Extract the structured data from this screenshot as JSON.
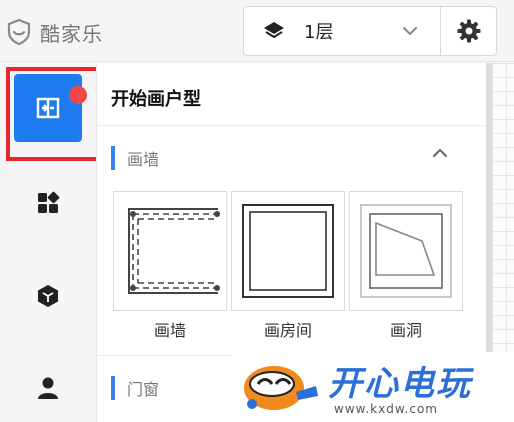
{
  "brand": {
    "name": "酷家乐",
    "logo_icon": "shield-logo-icon"
  },
  "header": {
    "floor_select": {
      "value": "1层",
      "icon": "layers-icon",
      "caret_icon": "chevron-down-icon"
    },
    "settings_icon": "gear-icon"
  },
  "nav": {
    "items": [
      {
        "id": "floorplan",
        "icon": "floorplan-icon",
        "active": true,
        "has_notice": true
      },
      {
        "id": "catalog",
        "icon": "grid-icon",
        "active": false
      },
      {
        "id": "models",
        "icon": "cube-icon",
        "active": false
      },
      {
        "id": "account",
        "icon": "user-icon",
        "active": false
      }
    ]
  },
  "panel": {
    "title": "开始画户型",
    "sections": [
      {
        "label": "画墙",
        "expanded": true,
        "tools": [
          {
            "label": "画墙",
            "icon": "draw-wall-icon"
          },
          {
            "label": "画房间",
            "icon": "draw-room-icon"
          },
          {
            "label": "画洞",
            "icon": "draw-hole-icon"
          }
        ]
      },
      {
        "label": "门窗",
        "expanded": false
      }
    ]
  },
  "watermark": {
    "title": "开心电玩",
    "url": "www.kxdw.com"
  },
  "colors": {
    "accent": "#1e7bf0",
    "section_bar": "#3b82f0",
    "notice": "#f04848",
    "highlight": "#e8262d"
  }
}
